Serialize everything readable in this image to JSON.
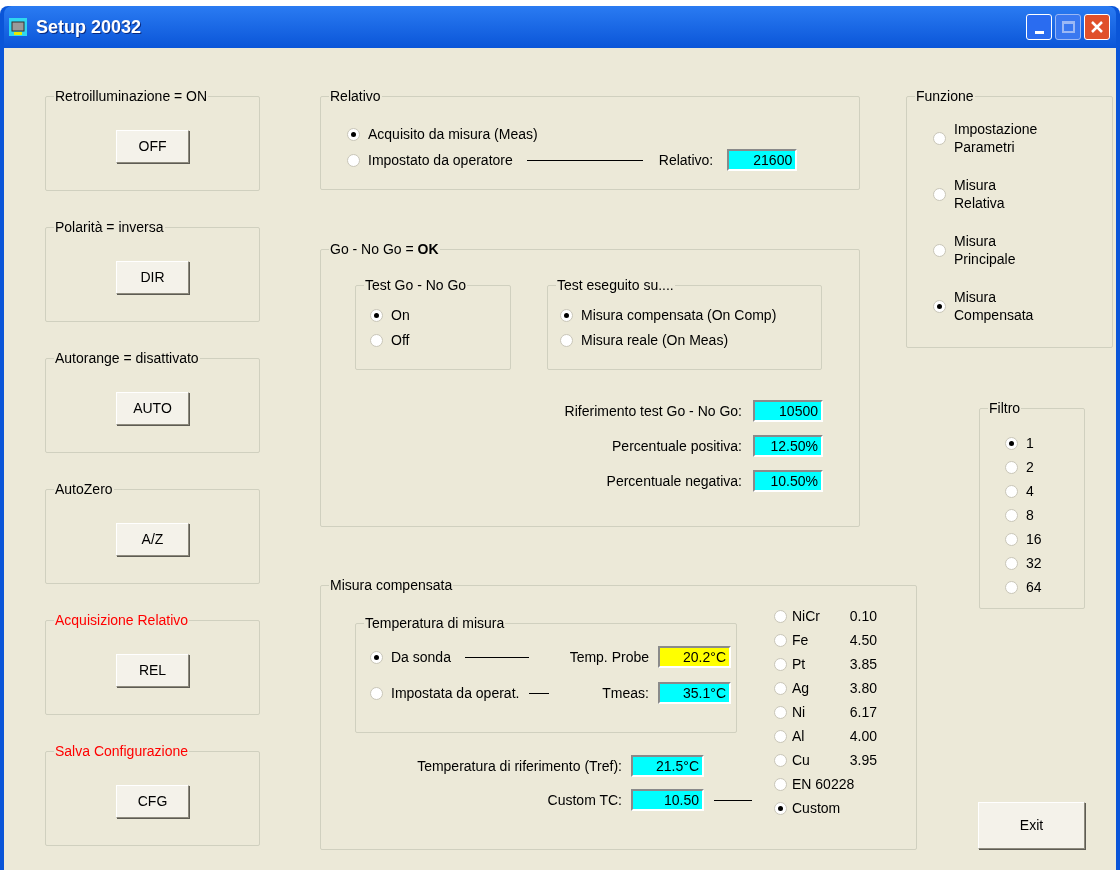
{
  "window": {
    "title": "Setup 20032"
  },
  "left_groups": [
    {
      "title": "Retroilluminazione = ON",
      "color": "#000000",
      "button": "OFF"
    },
    {
      "title": "Polarità = inversa",
      "color": "#000000",
      "button": "DIR"
    },
    {
      "title": "Autorange = disattivato",
      "color": "#000000",
      "button": "AUTO"
    },
    {
      "title": "AutoZero",
      "color": "#000000",
      "button": "A/Z"
    },
    {
      "title": "Acquisizione Relativo",
      "color": "#ff0000",
      "button": "REL"
    },
    {
      "title": "Salva Configurazione",
      "color": "#ff0000",
      "button": "CFG"
    }
  ],
  "relativo": {
    "title": "Relativo",
    "options": [
      {
        "label": "Acquisito da misura (Meas)",
        "selected": true
      },
      {
        "label": "Impostato da operatore",
        "selected": false
      }
    ],
    "field_label": "Relativo:",
    "value": "21600"
  },
  "go_no_go": {
    "title": "Go - No Go = **OK**",
    "test": {
      "title": "Test Go - No Go",
      "options": [
        {
          "label": "On",
          "selected": true
        },
        {
          "label": "Off",
          "selected": false
        }
      ]
    },
    "target": {
      "title": "Test eseguito su....",
      "options": [
        {
          "label": "Misura compensata (On Comp)",
          "selected": true
        },
        {
          "label": "Misura reale (On Meas)",
          "selected": false
        }
      ]
    },
    "fields": [
      {
        "label": "Riferimento test Go - No Go:",
        "value": "10500"
      },
      {
        "label": "Percentuale positiva:",
        "value": "12.50%"
      },
      {
        "label": "Percentuale negativa:",
        "value": "10.50%"
      }
    ]
  },
  "misura_compensata": {
    "title": "Misura compensata",
    "temperatura": {
      "title": "Temperatura di misura",
      "options": [
        {
          "label": "Da sonda",
          "selected": true,
          "field_label": "Temp. Probe",
          "value": "20.2°C",
          "color": "#ffff00"
        },
        {
          "label": "Impostata da operat.",
          "selected": false,
          "field_label": "Tmeas:",
          "value": "35.1°C",
          "color": "#00ffff"
        }
      ]
    },
    "fields": [
      {
        "label": "Temperatura di riferimento (Tref):",
        "value": "21.5°C"
      },
      {
        "label": "Custom TC:",
        "value": "10.50"
      }
    ],
    "materials": [
      {
        "name": "NiCr",
        "value": "0.10",
        "selected": false
      },
      {
        "name": "Fe",
        "value": "4.50",
        "selected": false
      },
      {
        "name": "Pt",
        "value": "3.85",
        "selected": false
      },
      {
        "name": "Ag",
        "value": "3.80",
        "selected": false
      },
      {
        "name": "Ni",
        "value": "6.17",
        "selected": false
      },
      {
        "name": "Al",
        "value": "4.00",
        "selected": false
      },
      {
        "name": "Cu",
        "value": "3.95",
        "selected": false
      },
      {
        "name": "EN 60228",
        "selected": false
      },
      {
        "name": "Custom",
        "selected": true
      }
    ]
  },
  "funzione": {
    "title": "Funzione",
    "options": [
      {
        "label": "Impostazione Parametri",
        "selected": false
      },
      {
        "label": "Misura Relativa",
        "selected": false
      },
      {
        "label": "Misura Principale",
        "selected": false
      },
      {
        "label": "Misura Compensata",
        "selected": true
      }
    ]
  },
  "filtro": {
    "title": "Filtro",
    "options": [
      {
        "label": "1",
        "selected": true
      },
      {
        "label": "2",
        "selected": false
      },
      {
        "label": "4",
        "selected": false
      },
      {
        "label": "8",
        "selected": false
      },
      {
        "label": "16",
        "selected": false
      },
      {
        "label": "32",
        "selected": false
      },
      {
        "label": "64",
        "selected": false
      }
    ]
  },
  "exit_button": "Exit"
}
